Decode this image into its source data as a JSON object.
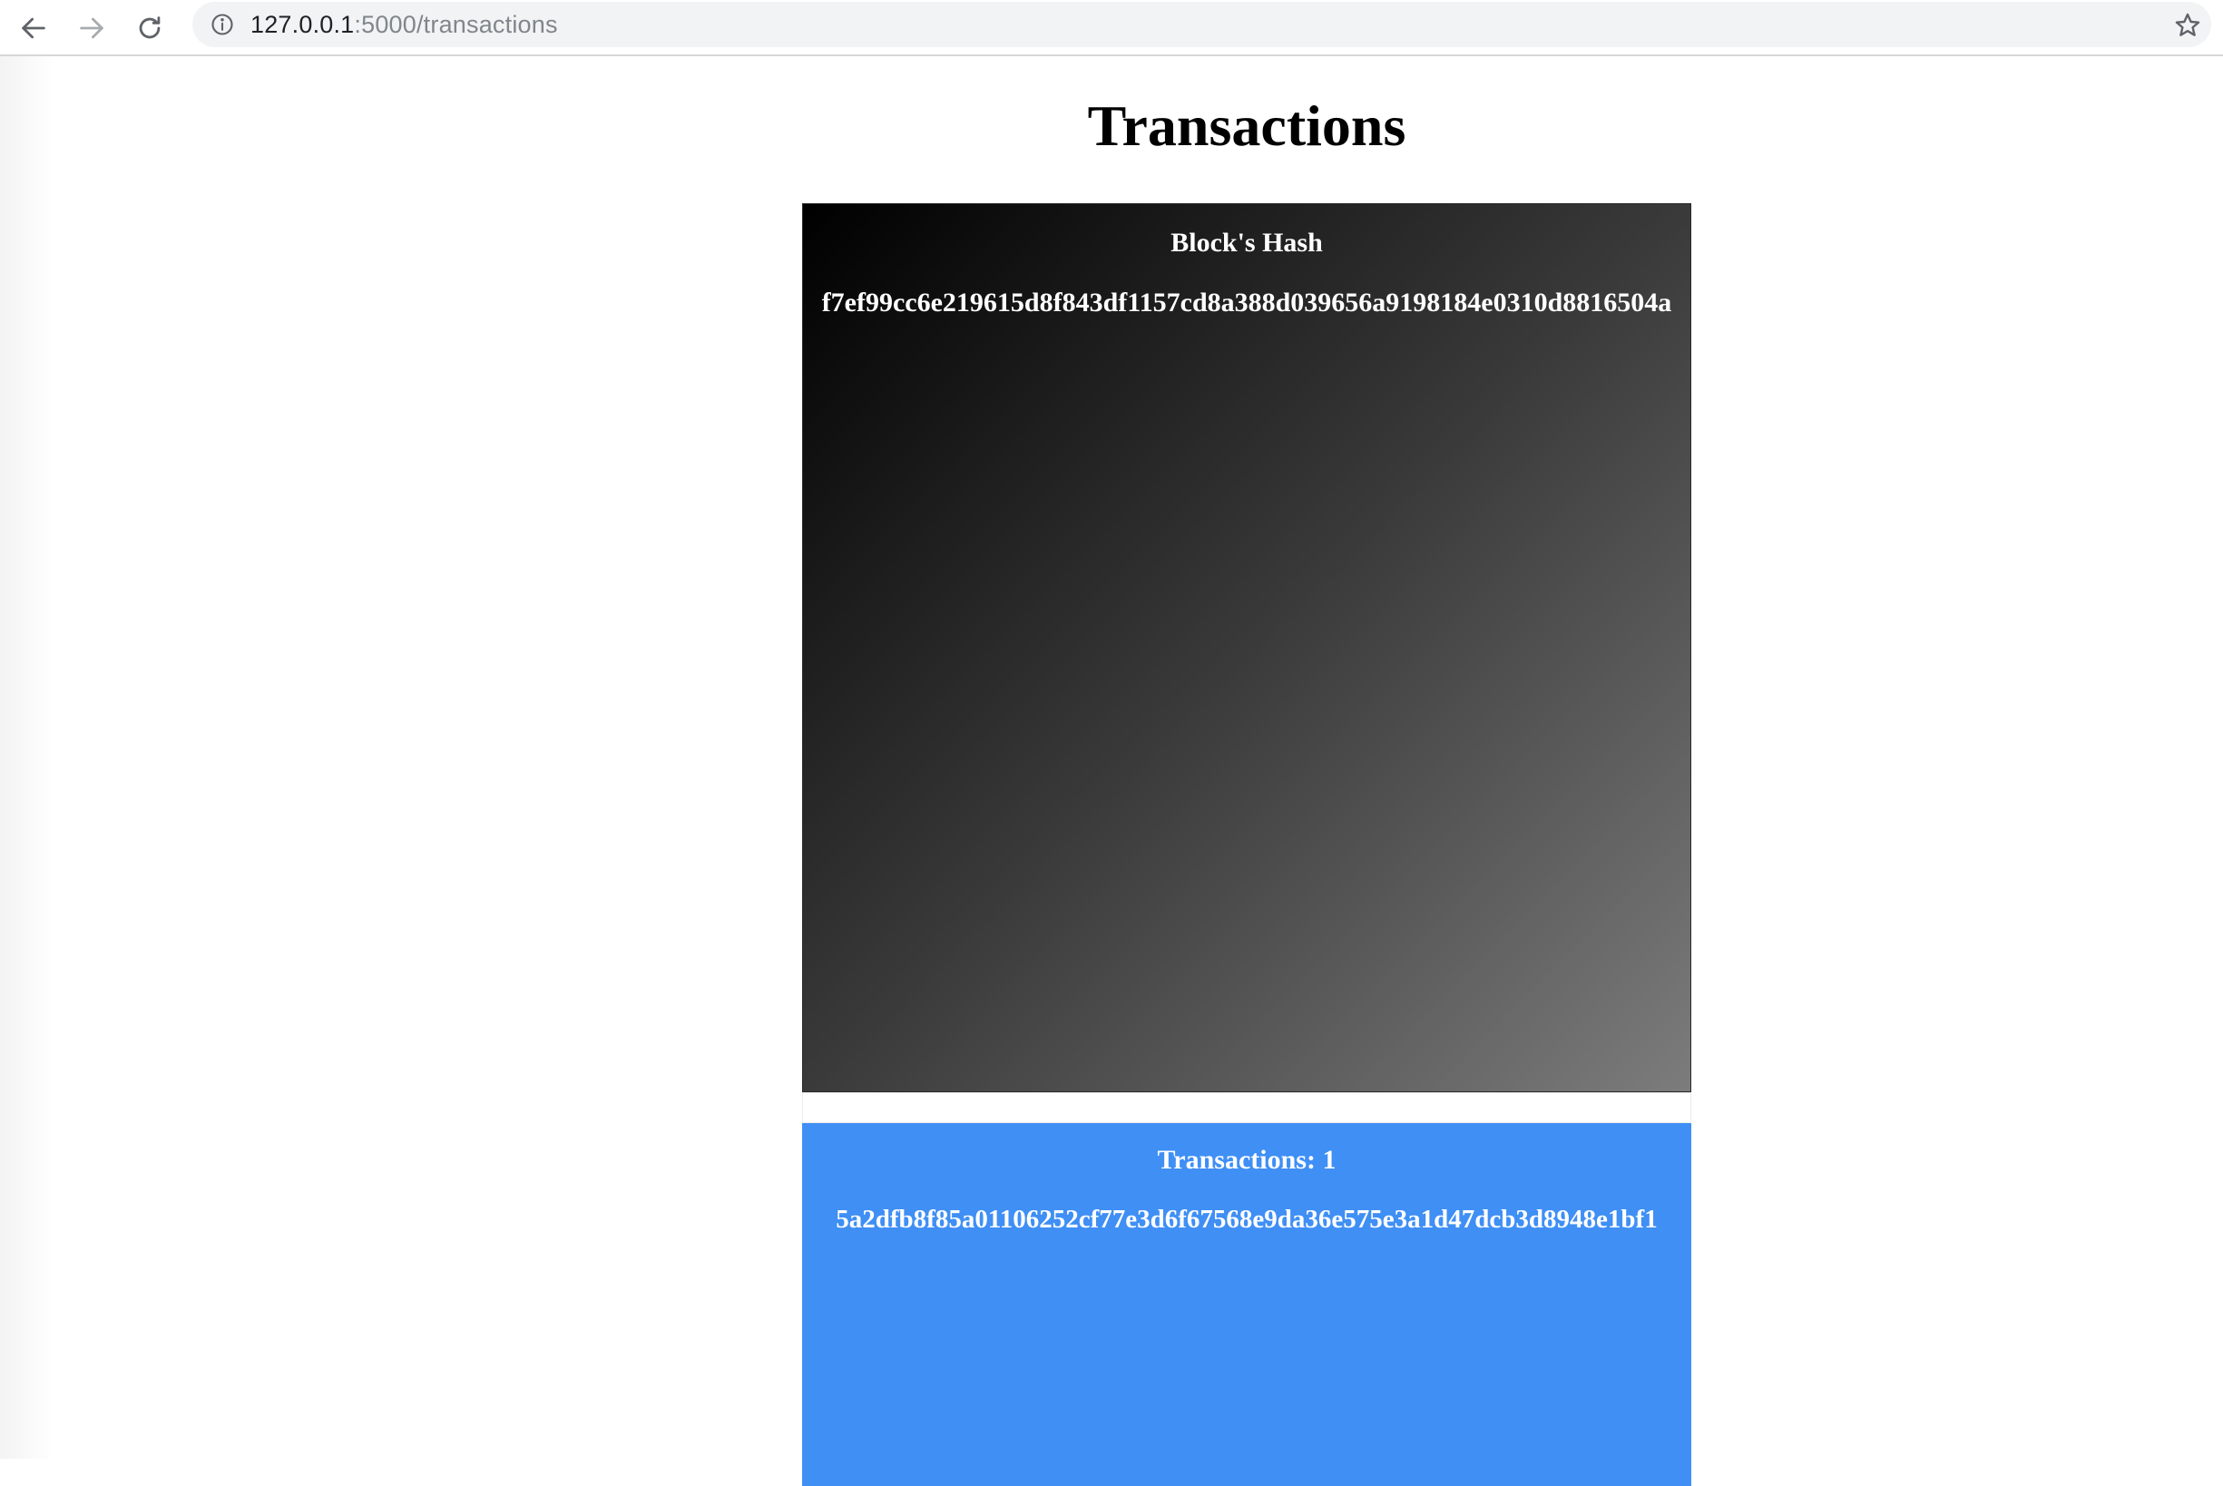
{
  "browser": {
    "url_host": "127.0.0.1",
    "url_path": ":5000/transactions",
    "icons": {
      "back": "arrow-left-icon",
      "forward": "arrow-right-icon",
      "reload": "reload-icon",
      "info": "info-icon",
      "bookmark": "star-icon"
    }
  },
  "page": {
    "title": "Transactions",
    "block": {
      "heading": "Block's Hash",
      "hash": "f7ef99cc6e219615d8f843df1157cd8a388d039656a9198184e0310d8816504a"
    },
    "transactions": {
      "heading": "Transactions: 1",
      "items": [
        "5a2dfb8f85a01106252cf77e3d6f67568e9da36e575e3a1d47dcb3d8948e1bf1"
      ]
    }
  },
  "colors": {
    "tx_card": "#3f8ff5",
    "block_gradient_start": "#000000",
    "block_gradient_end": "#7c7c7c"
  }
}
